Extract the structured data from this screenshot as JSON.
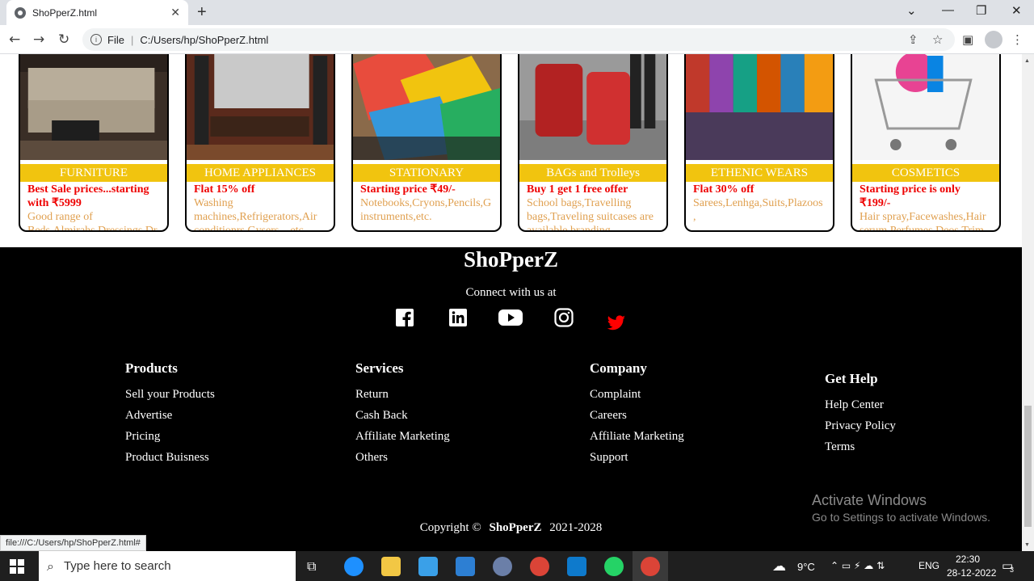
{
  "browser": {
    "tab_title": "ShoPperZ.html",
    "tab_close": "✕",
    "new_tab": "+",
    "file_label": "File",
    "address": "C:/Users/hp/ShoPperZ.html",
    "status_url": "file:///C:/Users/hp/ShoPperZ.html#"
  },
  "cards": [
    {
      "title": "FURNITURE",
      "offer": "Best Sale prices...starting with ₹5999",
      "desc": "Good range of Beds,Almirahs,Dressings,Dr"
    },
    {
      "title": "HOME APPLIANCES",
      "offer": "Flat 15% off",
      "desc": "Washing machines,Refrigerators,Air conditionrs,Gysers....etc."
    },
    {
      "title": "STATIONARY",
      "offer": "Starting price ₹49/-",
      "desc": "Notebooks,Cryons,Pencils,G instruments,etc."
    },
    {
      "title": "BAGs and Trolleys",
      "offer": "Buy 1 get 1 free offer",
      "desc": "School bags,Travelling bags,Traveling suitcases are available branding"
    },
    {
      "title": "ETHENIC WEARS",
      "offer": "Flat 30% off",
      "desc": "Sarees,Lenhga,Suits,Plazoos,"
    },
    {
      "title": "COSMETICS",
      "offer": "Starting price is only ₹199/-",
      "desc": "Hair spray,Facewashes,Hair serum,Perfumes,Deos,Trimm"
    }
  ],
  "footer": {
    "brand": "ShoPperZ",
    "connect": "Connect with us at",
    "social": [
      "facebook-icon",
      "linkedin-icon",
      "youtube-icon",
      "instagram-icon",
      "twitter-icon"
    ],
    "columns": [
      {
        "heading": "Products",
        "links": [
          "Sell your Products",
          "Advertise",
          "Pricing",
          "Product Buisness"
        ]
      },
      {
        "heading": "Services",
        "links": [
          "Return",
          "Cash Back",
          "Affiliate Marketing",
          "Others"
        ]
      },
      {
        "heading": "Company",
        "links": [
          "Complaint",
          "Careers",
          "Affiliate Marketing",
          "Support"
        ]
      },
      {
        "heading": "Get Help",
        "links": [
          "Help Center",
          "Privacy Policy",
          "Terms"
        ]
      }
    ],
    "copyright_prefix": "Copyright ©",
    "copyright_brand": "ShoPperZ",
    "copyright_years": "2021-2028"
  },
  "watermark": {
    "line1": "Activate Windows",
    "line2": "Go to Settings to activate Windows."
  },
  "taskbar": {
    "search_placeholder": "Type here to search",
    "weather": "9°C",
    "lang": "ENG",
    "time": "22:30",
    "date": "28-12-2022",
    "notif_count": "3"
  },
  "colors": {
    "accent": "#f1c40f",
    "offer": "#ee0000",
    "desc": "#e0a050",
    "twitter": "#ff0000"
  }
}
